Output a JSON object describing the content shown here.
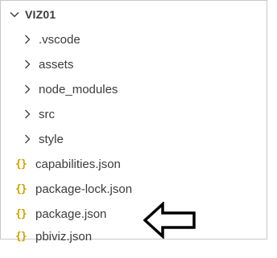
{
  "explorer": {
    "root": {
      "label": "VIZ01",
      "expanded": true,
      "icon": "chevron-down-icon"
    },
    "folders": [
      {
        "label": ".vscode",
        "icon": "chevron-right-icon"
      },
      {
        "label": "assets",
        "icon": "chevron-right-icon"
      },
      {
        "label": "node_modules",
        "icon": "chevron-right-icon"
      },
      {
        "label": "src",
        "icon": "chevron-right-icon"
      },
      {
        "label": "style",
        "icon": "chevron-right-icon"
      }
    ],
    "files": [
      {
        "label": "capabilities.json",
        "icon": "json-file-icon",
        "glyph": "{}"
      },
      {
        "label": "package-lock.json",
        "icon": "json-file-icon",
        "glyph": "{}"
      },
      {
        "label": "package.json",
        "icon": "json-file-icon",
        "glyph": "{}"
      },
      {
        "label": "pbiviz.json",
        "icon": "json-file-icon",
        "glyph": "{}"
      }
    ],
    "annotation": {
      "icon": "left-arrow-icon",
      "points_to": "package.json"
    }
  },
  "colors": {
    "text": "#3b3b3b",
    "json_icon": "#c8a200",
    "border": "#c8c8c8",
    "arrow_stroke": "#000000"
  }
}
